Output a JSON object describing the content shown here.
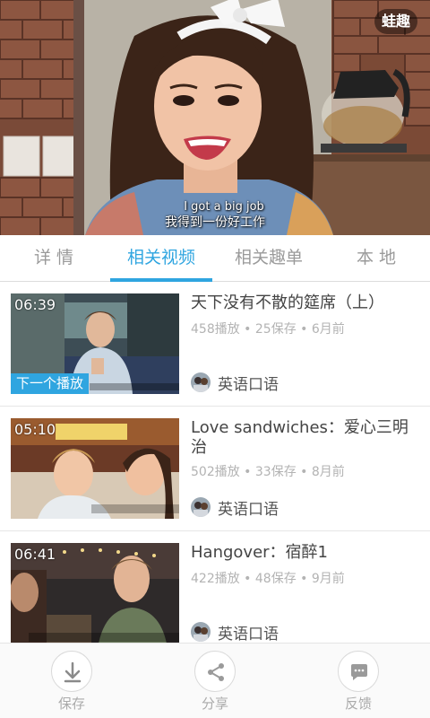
{
  "player": {
    "brand": "蛙趣",
    "subtitle_en": "I got a big job",
    "subtitle_zh": "我得到一份好工作"
  },
  "tabs": [
    {
      "label": "详 情",
      "active": false
    },
    {
      "label": "相关视频",
      "active": true
    },
    {
      "label": "相关趣单",
      "active": false
    },
    {
      "label": "本 地",
      "active": false
    }
  ],
  "related": [
    {
      "duration": "06:39",
      "badge": "下一个播放",
      "title": "天下没有不散的筵席（上）",
      "stats": "458播放 • 25保存 • 6月前",
      "channel": "英语口语"
    },
    {
      "duration": "05:10",
      "title": "Love sandwiches：爱心三明治",
      "stats": "502播放 • 33保存 • 8月前",
      "channel": "英语口语"
    },
    {
      "duration": "06:41",
      "title": "Hangover：宿醉1",
      "stats": "422播放 • 48保存 • 9月前",
      "channel": "英语口语"
    }
  ],
  "actions": [
    {
      "label": "保存",
      "icon": "download-icon"
    },
    {
      "label": "分享",
      "icon": "share-icon"
    },
    {
      "label": "反馈",
      "icon": "feedback-icon"
    }
  ],
  "colors": {
    "accent": "#2fa5e0",
    "muted_text": "#b3b3b3"
  }
}
